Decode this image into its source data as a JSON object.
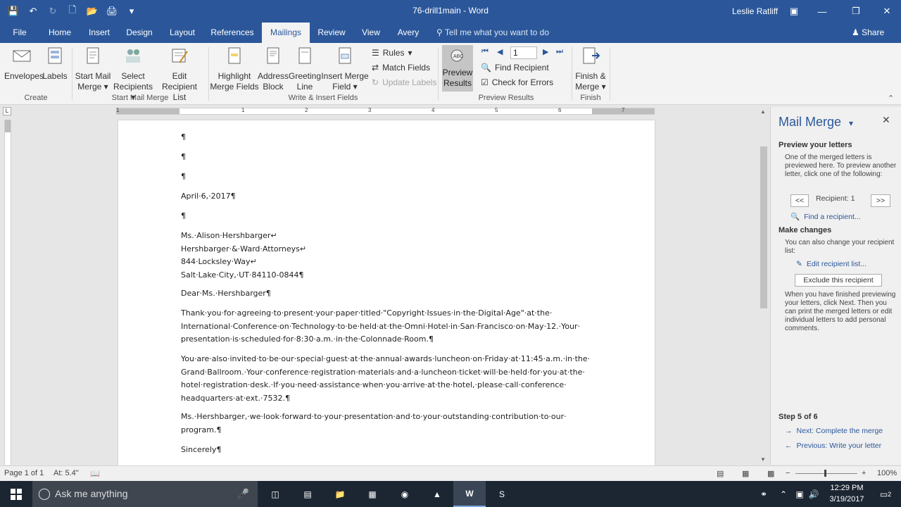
{
  "window": {
    "title": "76-drill1main  -  Word",
    "user": "Leslie Ratliff"
  },
  "tabs": [
    {
      "label": "File"
    },
    {
      "label": "Home"
    },
    {
      "label": "Insert"
    },
    {
      "label": "Design"
    },
    {
      "label": "Layout"
    },
    {
      "label": "References"
    },
    {
      "label": "Mailings"
    },
    {
      "label": "Review"
    },
    {
      "label": "View"
    },
    {
      "label": "Avery"
    }
  ],
  "tellme": "Tell me what you want to do",
  "share": "Share",
  "ribbon": {
    "envelopes": "Envelopes",
    "labels": "Labels",
    "start_mail_merge_1": "Start Mail",
    "start_mail_merge_2": "Merge",
    "select_recipients_1": "Select",
    "select_recipients_2": "Recipients",
    "edit_list_1": "Edit",
    "edit_list_2": "Recipient List",
    "highlight_1": "Highlight",
    "highlight_2": "Merge Fields",
    "address_1": "Address",
    "address_2": "Block",
    "greeting_1": "Greeting",
    "greeting_2": "Line",
    "insert_field_1": "Insert Merge",
    "insert_field_2": "Field",
    "rules": "Rules",
    "match_fields": "Match Fields",
    "update_labels": "Update Labels",
    "preview_1": "Preview",
    "preview_2": "Results",
    "record_number": "1",
    "find_recipient": "Find Recipient",
    "check_errors": "Check for Errors",
    "finish_1": "Finish &",
    "finish_2": "Merge",
    "groups": {
      "create": "Create",
      "start": "Start Mail Merge",
      "write": "Write & Insert Fields",
      "preview": "Preview Results",
      "finish": "Finish"
    }
  },
  "ruler": [
    "1",
    "1",
    "2",
    "3",
    "4",
    "5",
    "6",
    "7"
  ],
  "document": {
    "pilcrow_1": "¶",
    "pilcrow_2": "¶",
    "pilcrow_3": "¶",
    "date": "April·6,·2017¶",
    "pilcrow_4": "¶",
    "address": "Ms.·Alison·Hershbarger↵\nHershbarger·&·Ward·Attorneys↵\n844·Locksley·Way↵\nSalt·Lake·City,·UT·84110-0844¶",
    "salutation": "Dear·Ms.·Hershbarger¶",
    "para1": "Thank·you·for·agreeing·to·present·your·paper·titled·\"Copyright·Issues·in·the·Digital·Age\"·at·the·\nInternational·Conference·on·Technology·to·be·held·at·the·Omni·Hotel·in·San·Francisco·on·May·12.·Your·\npresentation·is·scheduled·for·8:30·a.m.·in·the·Colonnade·Room.¶",
    "para2": "You·are·also·invited·to·be·our·special·guest·at·the·annual·awards·luncheon·on·Friday·at·11:45·a.m.·in·the·\nGrand·Ballroom.·Your·conference·registration·materials·and·a·luncheon·ticket·will·be·held·for·you·at·the·\nhotel·registration·desk.·If·you·need·assistance·when·you·arrive·at·the·hotel,·please·call·conference·\nheadquarters·at·ext.·7532.¶",
    "para3": "Ms.·Hershbarger,·we·look·forward·to·your·presentation·and·to·your·outstanding·contribution·to·our·\nprogram.¶",
    "closing": "Sincerely¶"
  },
  "pane": {
    "title": "Mail Merge",
    "preview_heading": "Preview your letters",
    "preview_text": "One of the merged letters is previewed here. To preview another letter, click one of the following:",
    "prev_btn": "<<",
    "recipient": "Recipient: 1",
    "next_btn": ">>",
    "find_link": "Find a recipient...",
    "changes_heading": "Make changes",
    "changes_text": "You can also change your recipient list:",
    "edit_link": "Edit recipient list...",
    "exclude_btn": "Exclude this recipient",
    "finish_text": "When you have finished previewing your letters, click Next. Then you can print the merged letters or edit individual letters to add personal comments.",
    "step": "Step 5 of 6",
    "next_link": "Next: Complete the merge",
    "prev_link": "Previous: Write your letter"
  },
  "status": {
    "page": "Page 1 of 1",
    "at": "At: 5.4\"",
    "zoom": "100%"
  },
  "taskbar": {
    "search": "Ask me anything",
    "time": "12:29 PM",
    "date": "3/19/2017",
    "notifications": "2"
  },
  "colors": {
    "accent": "#2b579a",
    "taskbar": "#1c2633"
  }
}
